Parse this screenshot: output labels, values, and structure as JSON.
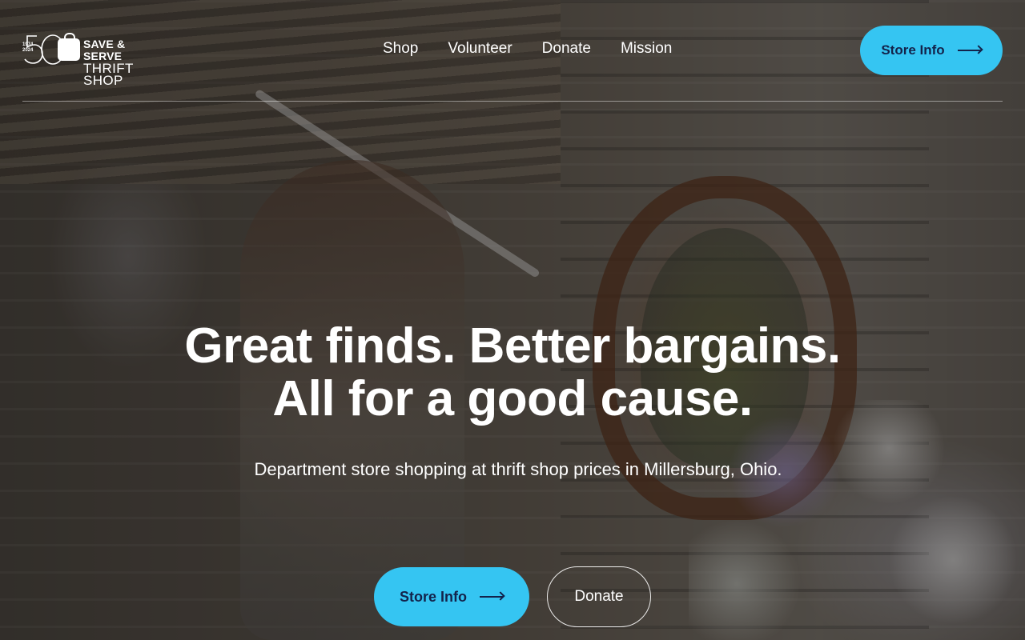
{
  "brand": {
    "line1": "SAVE & SERVE",
    "line2": "THRIFT SHOP",
    "year_start": "1974",
    "year_end": "2024",
    "anniversary": "50"
  },
  "nav": {
    "items": [
      {
        "label": "Shop"
      },
      {
        "label": "Volunteer"
      },
      {
        "label": "Donate"
      },
      {
        "label": "Mission"
      }
    ]
  },
  "header": {
    "store_info_label": "Store Info"
  },
  "hero": {
    "headline_line1": "Great finds. Better bargains.",
    "headline_line2": "All for a good cause.",
    "subtitle": "Department store shopping at thrift shop prices in Millersburg, Ohio.",
    "primary_cta": "Store Info",
    "secondary_cta": "Donate"
  },
  "colors": {
    "accent": "#35c5f2",
    "accent_text": "#13234b",
    "text": "#ffffff"
  },
  "icons": {
    "arrow": "arrow-right-icon",
    "logo": "shopping-bag-icon"
  }
}
